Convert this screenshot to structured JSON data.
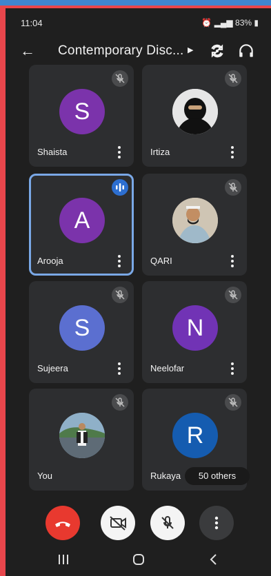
{
  "status": {
    "time": "11:04",
    "battery": "83%"
  },
  "header": {
    "title": "Contemporary Disc..."
  },
  "tiles": [
    {
      "name": "Shaista",
      "initial": "S",
      "color": "#7b33ab"
    },
    {
      "name": "Irtiza",
      "initial": ""
    },
    {
      "name": "Arooja",
      "initial": "A",
      "color": "#7b33ab"
    },
    {
      "name": "QARI",
      "initial": ""
    },
    {
      "name": "Sujeera",
      "initial": "S",
      "color": "#5b6fd0"
    },
    {
      "name": "Neelofar",
      "initial": "N",
      "color": "#7133b5"
    },
    {
      "name": "You",
      "initial": ""
    },
    {
      "name": "Rukaya",
      "initial": "R",
      "color": "#155cb0"
    }
  ],
  "others_label": "50 others",
  "colors": {
    "end_call": "#e8392f"
  }
}
